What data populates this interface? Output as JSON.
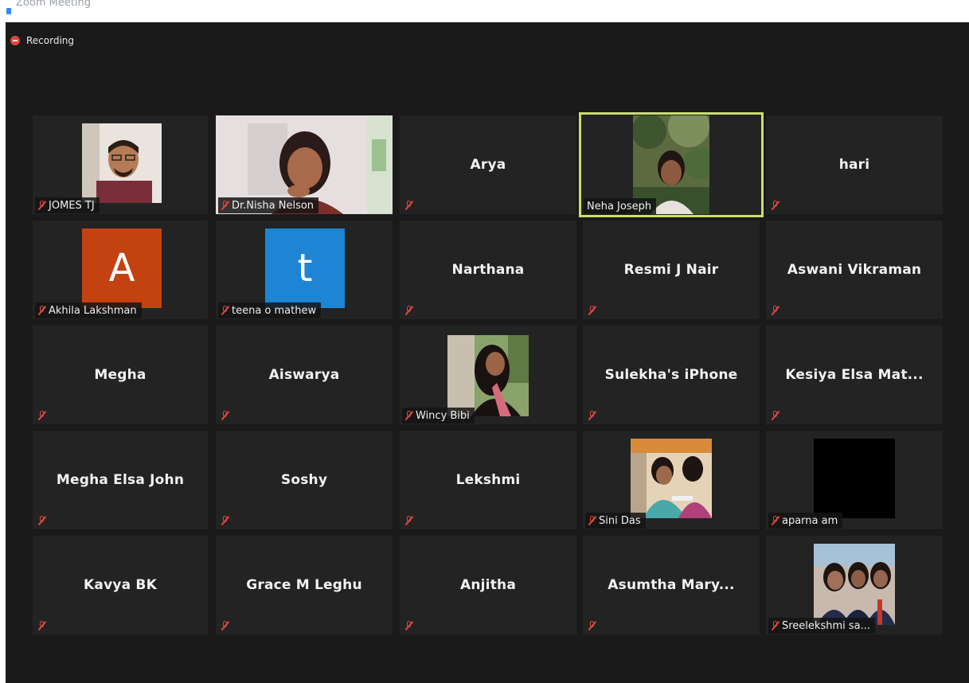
{
  "window": {
    "title": "Zoom Meeting"
  },
  "recording": {
    "label": "Recording",
    "color": "#e5433a"
  },
  "tiles": [
    {
      "name": "JOMES TJ",
      "muted": true,
      "video": "man-glasses-photo"
    },
    {
      "name": "Dr.Nisha Nelson",
      "muted": true,
      "video": "woman-indoor-photo"
    },
    {
      "name": "Arya",
      "muted": true,
      "video": null
    },
    {
      "name": "Neha Joseph",
      "muted": false,
      "video": "girl-outdoor-photo",
      "active_speaker": true
    },
    {
      "name": "hari",
      "muted": true,
      "video": null
    },
    {
      "name": "Akhila Lakshman",
      "muted": true,
      "avatar_letter": "A",
      "avatar_color": "#c4420f"
    },
    {
      "name": "teena o mathew",
      "muted": true,
      "avatar_letter": "t",
      "avatar_color": "#1d85d4"
    },
    {
      "name": "Narthana",
      "muted": true,
      "video": null
    },
    {
      "name": "Resmi J Nair",
      "muted": true,
      "video": null
    },
    {
      "name": "Aswani Vikraman",
      "muted": true,
      "video": null
    },
    {
      "name": "Megha",
      "muted": true,
      "video": null
    },
    {
      "name": "Aiswarya",
      "muted": true,
      "video": null
    },
    {
      "name": "Wincy Bibi",
      "muted": true,
      "video": "woman-pink-scarf-photo"
    },
    {
      "name": "Sulekha's iPhone",
      "muted": true,
      "video": null
    },
    {
      "name": "Kesiya Elsa Mat...",
      "muted": true,
      "video": null
    },
    {
      "name": "Megha Elsa John",
      "muted": true,
      "video": null
    },
    {
      "name": "Soshy",
      "muted": true,
      "video": null
    },
    {
      "name": "Lekshmi",
      "muted": true,
      "video": null
    },
    {
      "name": "Sini Das",
      "muted": true,
      "video": "group-photo"
    },
    {
      "name": "aparna am",
      "muted": true,
      "video": "black-frame"
    },
    {
      "name": "Kavya BK",
      "muted": true,
      "video": null
    },
    {
      "name": "Grace M Leghu",
      "muted": true,
      "video": null
    },
    {
      "name": "Anjitha",
      "muted": true,
      "video": null
    },
    {
      "name": "Asumtha Mary...",
      "muted": true,
      "video": null
    },
    {
      "name": "Sreelekshmi sa...",
      "muted": true,
      "video": "selfie-group-photo"
    }
  ],
  "colors": {
    "stage_bg": "#1a1a1a",
    "tile_bg": "#232323",
    "active_border": "#c9df6a",
    "muted_icon": "#e0483f"
  }
}
